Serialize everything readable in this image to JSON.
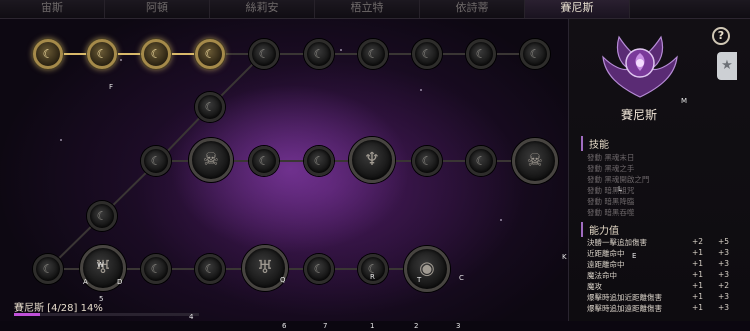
{
  "tabs": [
    {
      "label": "宙斯",
      "active": false
    },
    {
      "label": "阿頓",
      "active": false
    },
    {
      "label": "絲莉安",
      "active": false
    },
    {
      "label": "梧立特",
      "active": false
    },
    {
      "label": "依詩蒂",
      "active": false
    },
    {
      "label": "賽尼斯",
      "active": true
    }
  ],
  "tree": {
    "node_labels": [
      "F",
      "W",
      "A",
      "D",
      "5",
      "Q",
      "R",
      "T",
      "C",
      "K"
    ],
    "lit_nodes": 4
  },
  "progress": {
    "text": "賽尼斯 [4/28] 14%",
    "fraction": 0.14,
    "marker": "4"
  },
  "hotkeys": [
    "6",
    "7",
    "1",
    "2",
    "3"
  ],
  "panel": {
    "hero_name": "賽尼斯",
    "emblem_mark": "M",
    "skills_title": "技能",
    "skills": [
      "發動 黑魂末日",
      "發動 黑魂之手",
      "發動 黑魂開啟之門",
      "發動 暗黑詛咒",
      "發動 暗黑降臨",
      "發動 暗黑吞噬"
    ],
    "skills_mark": "L",
    "stats_title": "能力值",
    "stats": [
      {
        "name": "決勝一擊追加傷害",
        "a": "+2",
        "b": "+5"
      },
      {
        "name": "近距離命中",
        "a": "+1",
        "b": "+3"
      },
      {
        "name": "遠距離命中",
        "a": "+1",
        "b": "+3"
      },
      {
        "name": "魔法命中",
        "a": "+1",
        "b": "+3"
      },
      {
        "name": "魔攻",
        "a": "+1",
        "b": "+2"
      },
      {
        "name": "爆擊時追加近距離傷害",
        "a": "+1",
        "b": "+3"
      },
      {
        "name": "爆擊時追加遠距離傷害",
        "a": "+1",
        "b": "+3"
      }
    ],
    "stats_mark": "E",
    "help_icon": "question-icon",
    "side_tab_icon": "star-icon",
    "accent": "#a06cc0"
  },
  "colors": {
    "lit_gold": "#a58a4a",
    "progress_fill": "#c050d8",
    "nebula": "#6a2a8a"
  }
}
